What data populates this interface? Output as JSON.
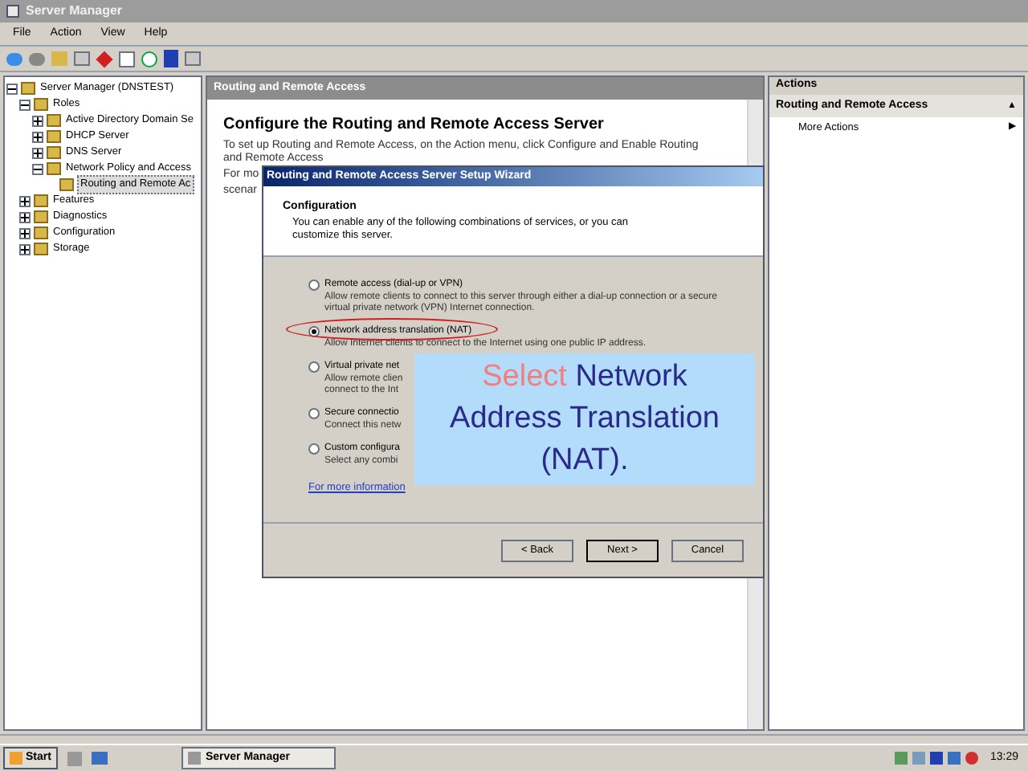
{
  "window": {
    "title": "Server Manager"
  },
  "menu": [
    "File",
    "Action",
    "View",
    "Help"
  ],
  "tree": [
    {
      "label": "Server Manager (DNSTEST)",
      "expanded": true,
      "children": [
        {
          "label": "Roles",
          "expanded": true,
          "children": [
            {
              "label": "Active Directory Domain Se",
              "expanded": false
            },
            {
              "label": "DHCP Server",
              "expanded": false
            },
            {
              "label": "DNS Server",
              "expanded": false
            },
            {
              "label": "Network Policy and Access",
              "expanded": true,
              "children": [
                {
                  "label": "Routing and Remote Ac",
                  "selected": true
                }
              ]
            }
          ]
        },
        {
          "label": "Features",
          "expanded": false
        },
        {
          "label": "Diagnostics",
          "expanded": false
        },
        {
          "label": "Configuration",
          "expanded": false
        },
        {
          "label": "Storage",
          "expanded": false
        }
      ]
    }
  ],
  "center": {
    "header": "Routing and Remote Access",
    "heading": "Configure the Routing and Remote Access Server",
    "paragraphs": [
      "To set up Routing and Remote Access, on the Action menu, click Configure and Enable Routing and Remote Access",
      "For mo",
      "scenar"
    ]
  },
  "actions": {
    "header": "Actions",
    "section": "Routing and Remote Access",
    "collapse_glyph": "▲",
    "items": [
      {
        "label": "More Actions",
        "glyph": "▶"
      }
    ]
  },
  "wizard": {
    "title": "Routing and Remote Access Server Setup Wizard",
    "heading": "Configuration",
    "intro": "You can enable any of the following combinations of services, or you can customize this server.",
    "options": [
      {
        "label": "Remote access (dial-up or VPN)",
        "description": "Allow remote clients to connect to this server through either a dial-up connection or a secure virtual private network (VPN) Internet connection.",
        "selected": false
      },
      {
        "label": "Network address translation (NAT)",
        "description": "Allow Internet clients to connect to the Internet using one public IP address.",
        "selected": true
      },
      {
        "label": "Virtual private net",
        "description": "Allow remote clien\nconnect to the Int",
        "selected": false
      },
      {
        "label": "Secure connectio",
        "description": "Connect this netw",
        "selected": false
      },
      {
        "label": "Custom configura",
        "description": "Select any combi",
        "selected": false
      }
    ],
    "link": "For more information",
    "buttons": [
      "< Back",
      "Next >",
      "Cancel"
    ]
  },
  "callout": {
    "highlight": "Select",
    "text": "Network Address Translation (NAT)."
  },
  "taskbar": {
    "start": "Start",
    "task": "Server Manager",
    "clock": "13:29"
  }
}
